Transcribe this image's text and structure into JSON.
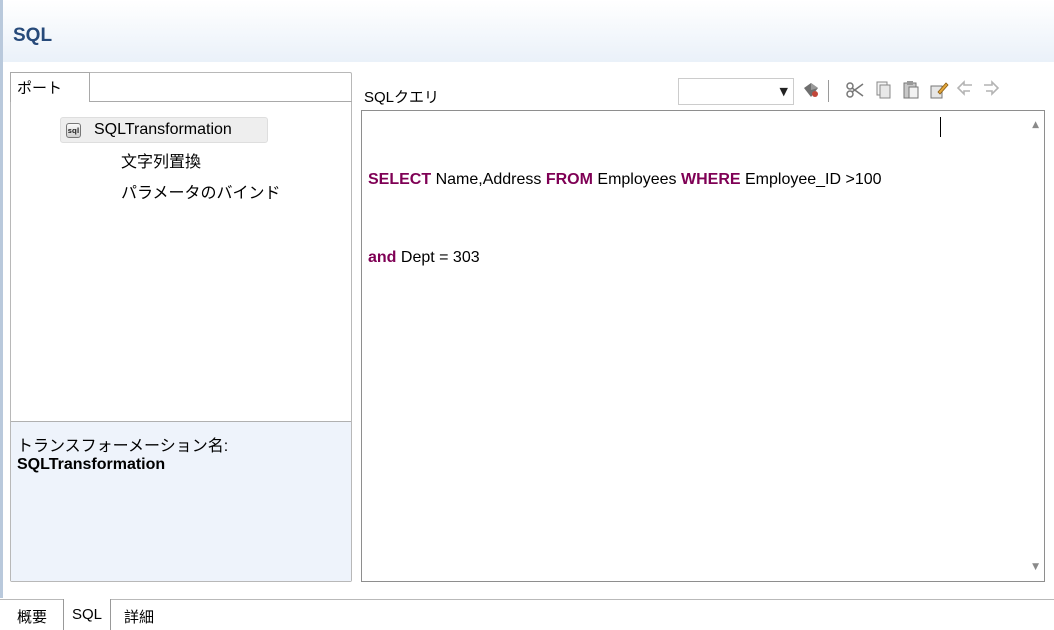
{
  "header": {
    "title": "SQL"
  },
  "left_panel": {
    "tab_label": "ポート",
    "tree": {
      "root": {
        "label": "SQLTransformation",
        "icon": "sql-icon"
      },
      "children": [
        "文字列置換",
        "パラメータのバインド"
      ]
    },
    "info": {
      "label": "トランスフォーメーション名:",
      "value": "SQLTransformation"
    }
  },
  "query": {
    "label": "SQLクエリ",
    "dropdown_value": "",
    "toolbar_icons": [
      "validate-icon",
      "cut-icon",
      "copy-icon",
      "paste-icon",
      "format-icon",
      "undo-icon",
      "redo-icon"
    ],
    "code_lines": [
      [
        {
          "text": "SELECT",
          "kw": true
        },
        {
          "text": " Name,Address ",
          "kw": false
        },
        {
          "text": "FROM",
          "kw": true
        },
        {
          "text": " Employees ",
          "kw": false
        },
        {
          "text": "WHERE",
          "kw": true
        },
        {
          "text": " Employee_ID >100",
          "kw": false
        }
      ],
      [
        {
          "text": "and",
          "kw": true
        },
        {
          "text": " Dept = 303",
          "kw": false
        }
      ]
    ],
    "keyword_color": "#7f0055"
  },
  "bottom_tabs": [
    {
      "label": "概要",
      "active": false
    },
    {
      "label": "SQL",
      "active": true
    },
    {
      "label": "詳細",
      "active": false
    }
  ]
}
